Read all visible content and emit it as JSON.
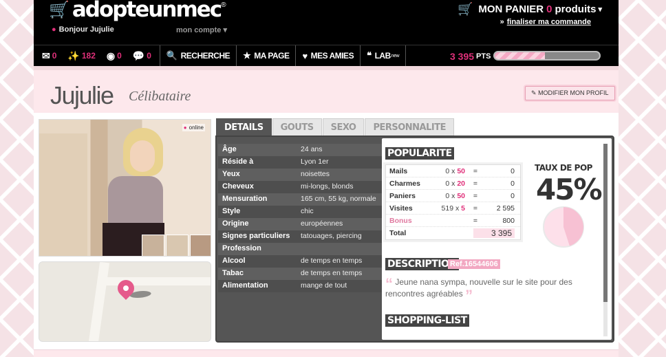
{
  "header": {
    "logo_text": "adopteunmec",
    "logo_reg": "®",
    "greeting": "Bonjour Jujulie",
    "account_label": "mon compte",
    "cart_prefix": "MON PANIER",
    "cart_count": "0",
    "cart_suffix": "produits",
    "checkout": "finaliser ma commande"
  },
  "nav": {
    "counters": [
      {
        "icon": "mail-icon",
        "value": "0"
      },
      {
        "icon": "wand-icon",
        "value": "182"
      },
      {
        "icon": "visit-icon",
        "value": "0"
      },
      {
        "icon": "chat-icon",
        "value": "0"
      }
    ],
    "items": [
      {
        "label": "RECHERCHE",
        "icon": "search-icon"
      },
      {
        "label": "MA PAGE",
        "icon": "star-icon"
      },
      {
        "label": "MES AMIES",
        "icon": "heart-icon"
      },
      {
        "label": "LAB",
        "icon": "quote-icon",
        "sup": "new"
      }
    ],
    "points": "3 395",
    "points_label": "PTS",
    "points_progress": 0.48
  },
  "profile": {
    "name": "Jujulie",
    "status": "Célibataire",
    "edit_label": "MODIFIER MON PROFIL",
    "online": "online"
  },
  "tabs": [
    "DETAILS",
    "GOUTS",
    "SEXO",
    "PERSONNALITE"
  ],
  "details": [
    {
      "k": "Âge",
      "v": "24 ans"
    },
    {
      "k": "Réside à",
      "v": "Lyon 1er"
    },
    {
      "k": "Yeux",
      "v": "noisettes"
    },
    {
      "k": "Cheveux",
      "v": "mi-longs, blonds"
    },
    {
      "k": "Mensuration",
      "v": "165 cm, 55 kg, normale"
    },
    {
      "k": "Style",
      "v": "chic"
    },
    {
      "k": "Origine",
      "v": "européennes"
    },
    {
      "k": "Signes particuliers",
      "v": "tatouages, piercing"
    },
    {
      "k": "Profession",
      "v": ""
    },
    {
      "k": "Alcool",
      "v": "de temps en temps"
    },
    {
      "k": "Tabac",
      "v": "de temps en temps"
    },
    {
      "k": "Alimentation",
      "v": "mange de tout"
    }
  ],
  "popularity": {
    "title": "POPULARITE",
    "rows": [
      {
        "k": "Mails",
        "count": "0",
        "mult": "50",
        "eq": "=",
        "v": "0"
      },
      {
        "k": "Charmes",
        "count": "0",
        "mult": "20",
        "eq": "=",
        "v": "0"
      },
      {
        "k": "Paniers",
        "count": "0",
        "mult": "50",
        "eq": "=",
        "v": "0"
      },
      {
        "k": "Visites",
        "count": "519",
        "mult": "5",
        "eq": "=",
        "v": "2 595"
      }
    ],
    "bonus_label": "Bonus",
    "bonus_value": "800",
    "total_label": "Total",
    "total_value": "3 395",
    "pop_title": "TAUX DE POP",
    "pop_value": "45%",
    "pop_fraction": 0.45
  },
  "description": {
    "title": "DESCRIPTION",
    "ref": "Ref.16544606",
    "text": "Jeune nana sympa, nouvelle sur le site pour des rencontres agréables"
  },
  "shopping": {
    "title": "SHOPPING-LIST"
  },
  "colors": {
    "accent": "#e0307a",
    "pink_light": "#fde8ec"
  }
}
